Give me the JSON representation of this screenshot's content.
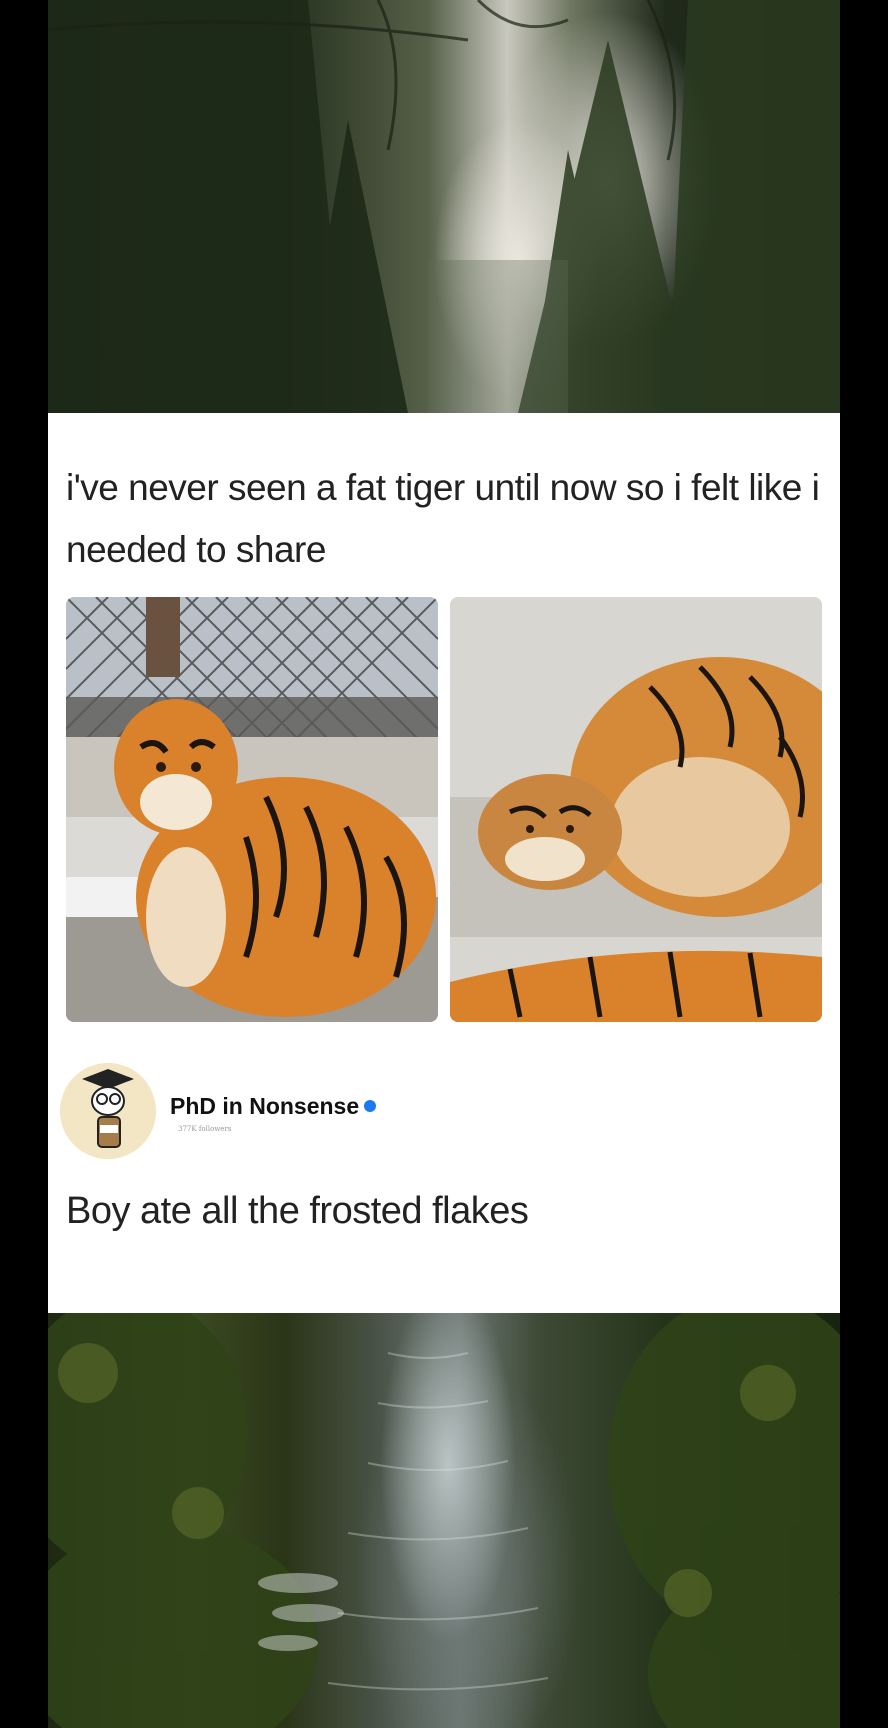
{
  "post": {
    "caption": "i've never seen a fat tiger until now so i felt like i needed to share",
    "author_name": "PhD in Nonsense",
    "author_followers": "377K followers",
    "comment": "Boy ate all the frosted flakes"
  },
  "images": {
    "left": "sitting-tiger-photo",
    "right": "lying-tiger-photo",
    "top_background": "forest-photo",
    "bottom_background": "stream-photo"
  },
  "colors": {
    "card": "#ffffff",
    "text": "#222222",
    "verified": "#1d79f2",
    "tiger_orange": "#d9822b"
  }
}
